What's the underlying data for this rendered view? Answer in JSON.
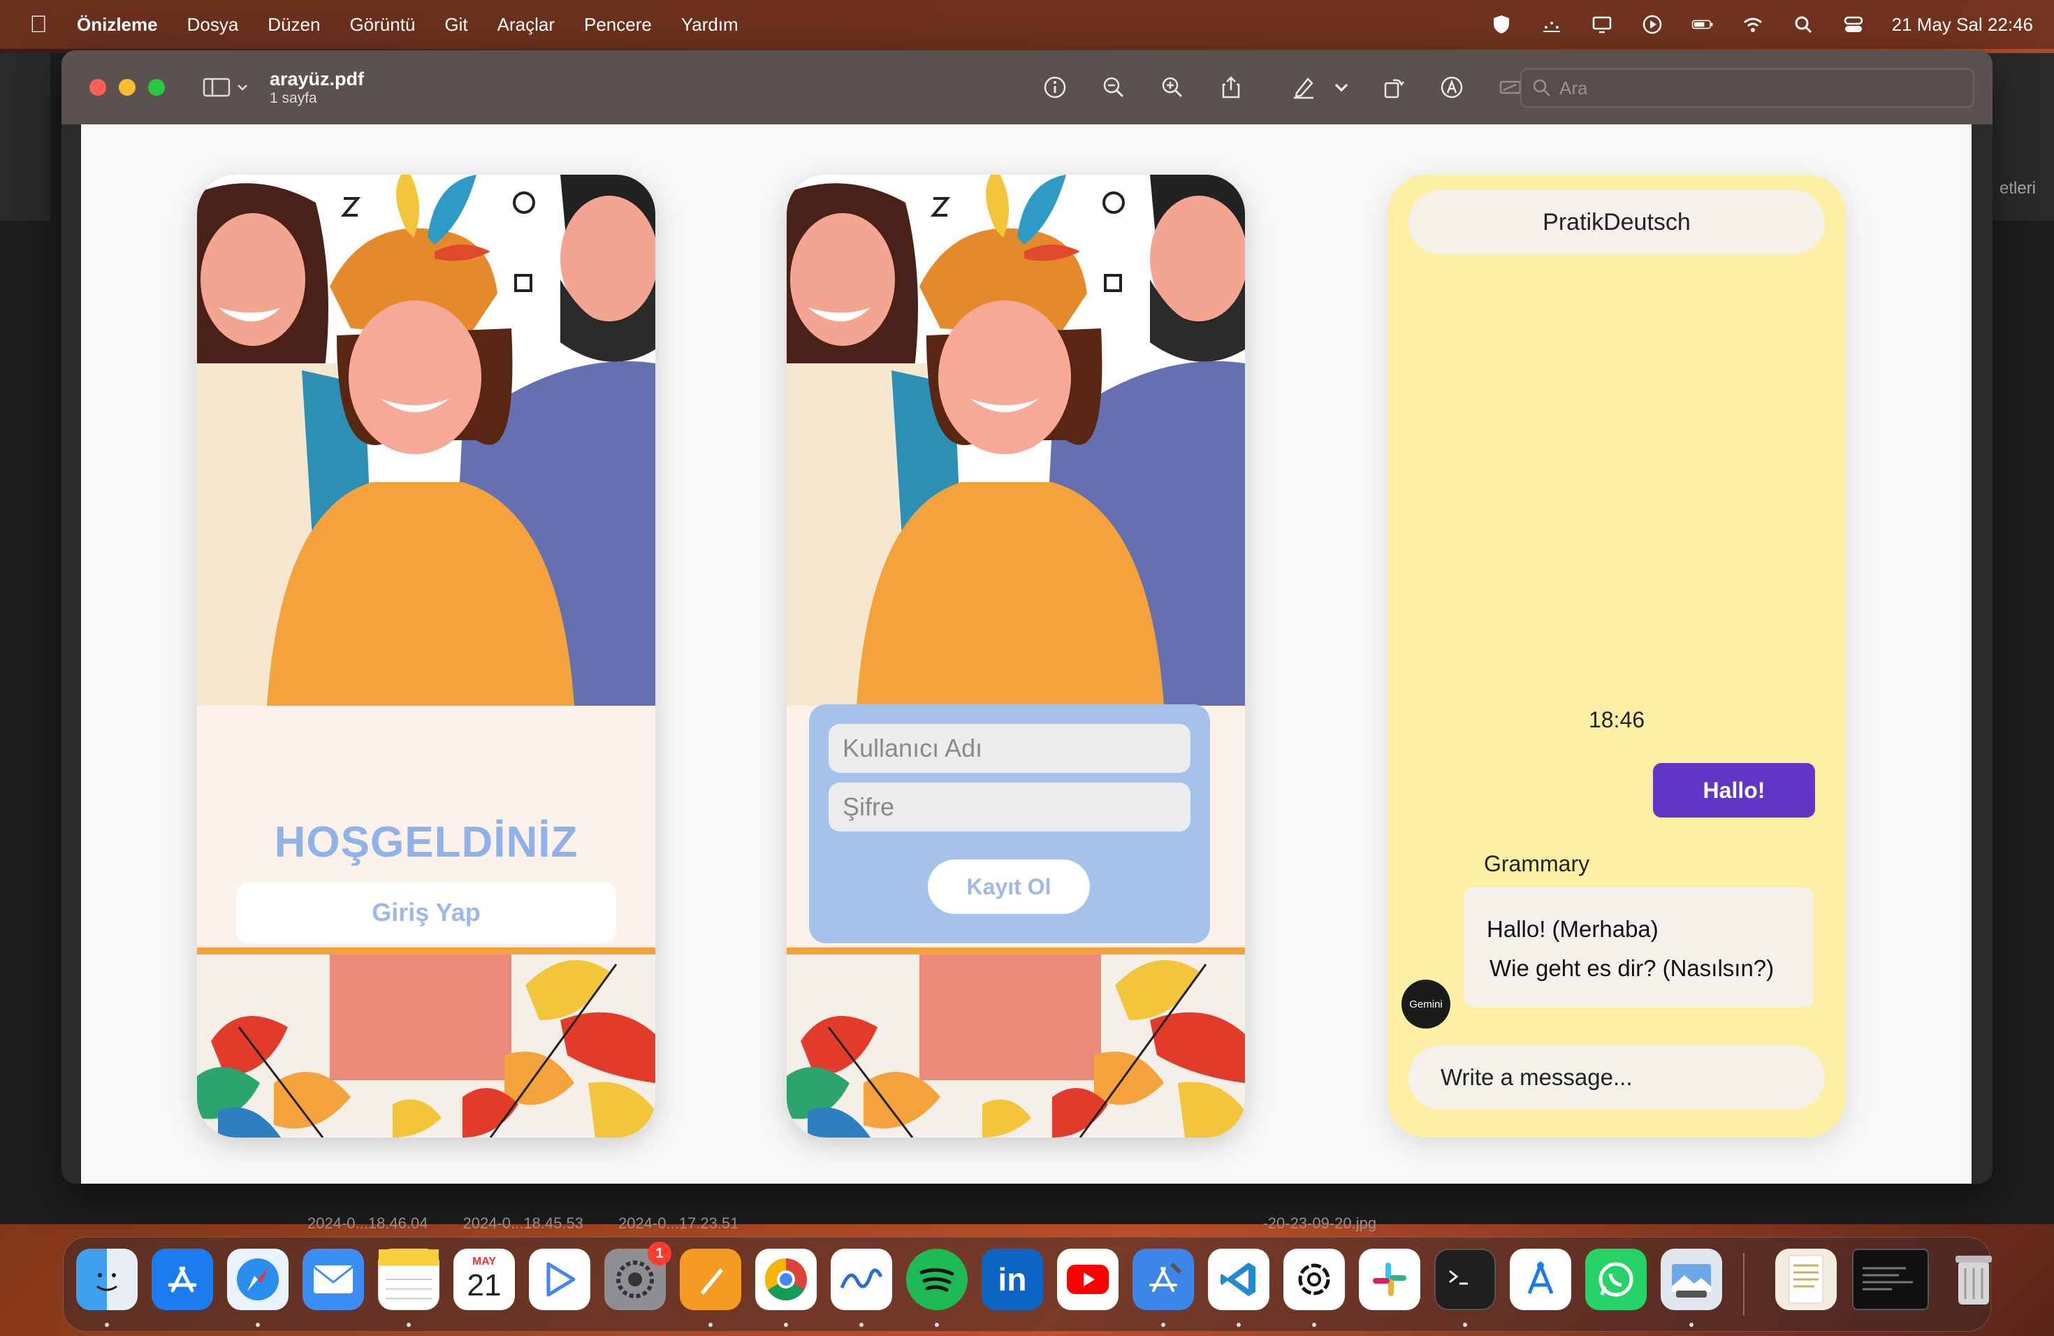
{
  "menubar": {
    "app_name": "Önizleme",
    "items": [
      "Dosya",
      "Düzen",
      "Görüntü",
      "Git",
      "Araçlar",
      "Pencere",
      "Yardım"
    ],
    "clock": "21 May Sal  22:46"
  },
  "background": {
    "right_text": "etleri",
    "strip_labels": [
      "2024-0...18.46.04",
      "2024-0...18.45.53",
      "2024-0...17.23.51",
      "-20-23-09-20.jpg"
    ]
  },
  "window": {
    "file_name": "arayüz.pdf",
    "page_count": "1 sayfa",
    "search_placeholder": "Ara"
  },
  "welcome_screen": {
    "title": "HOŞGELDİNİZ",
    "login_button": "Giriş Yap"
  },
  "login_screen": {
    "username_placeholder": "Kullanıcı Adı",
    "password_placeholder": "Şifre",
    "signup_button": "Kayıt Ol"
  },
  "chat_screen": {
    "header_title": "PratikDeutsch",
    "timestamp": "18:46",
    "user_message": "Hallo!",
    "bot_name": "Grammary",
    "bot_lines": [
      "Hallo! (Merhaba)",
      "Wie geht es dir? (Nasılsın?)"
    ],
    "bot_avatar_label": "Gemini",
    "input_placeholder": "Write a message..."
  },
  "dock": {
    "calendar_month": "MAY",
    "calendar_day": "21",
    "settings_badge": "1",
    "apps": [
      "finder-icon",
      "app-store-icon",
      "safari-icon",
      "mail-icon",
      "notes-icon",
      "calendar-icon",
      "google-play-icon",
      "system-settings-icon",
      "pages-icon",
      "chrome-icon",
      "freeform-icon",
      "spotify-icon",
      "linkedin-icon",
      "youtube-icon",
      "xcode-icon",
      "vscode-icon",
      "chatgpt-icon",
      "slack-icon",
      "terminal-icon",
      "xcode-instruments-icon",
      "whatsapp-icon",
      "preview-icon"
    ],
    "colors": {
      "accent_purple": "#6236c4",
      "chat_yellow": "#fdf0a4",
      "form_blue": "#a4c2ec",
      "title_blue": "#8fb3e8"
    }
  }
}
